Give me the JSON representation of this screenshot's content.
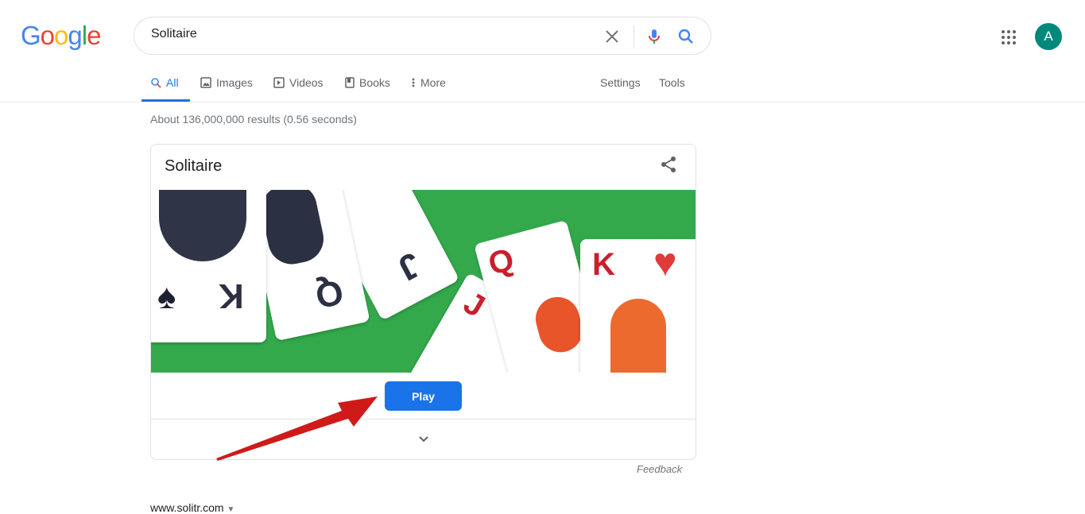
{
  "logo": {
    "letters": [
      "G",
      "o",
      "o",
      "g",
      "l",
      "e"
    ],
    "colors": [
      "#4285f4",
      "#ea4335",
      "#fbbc05",
      "#4285f4",
      "#34a853",
      "#ea4335"
    ]
  },
  "search": {
    "query": "Solitaire",
    "clear_icon": "close-icon",
    "voice_icon": "mic-icon",
    "search_icon": "search-icon"
  },
  "header": {
    "avatar_letter": "A",
    "avatar_color": "#00897b"
  },
  "tabs": [
    {
      "label": "All",
      "active": true
    },
    {
      "label": "Images"
    },
    {
      "label": "Videos"
    },
    {
      "label": "Books"
    },
    {
      "label": "More"
    }
  ],
  "tools": {
    "settings": "Settings",
    "tools": "Tools"
  },
  "stats": "About 136,000,000 results (0.56 seconds)",
  "card": {
    "title": "Solitaire",
    "play_label": "Play",
    "banner_color": "#34a94c",
    "cards": [
      "K",
      "Q",
      "J",
      "J",
      "Q",
      "K"
    ]
  },
  "feedback": "Feedback",
  "result": {
    "url": "www.solitr.com"
  },
  "accent": "#1a73e8"
}
